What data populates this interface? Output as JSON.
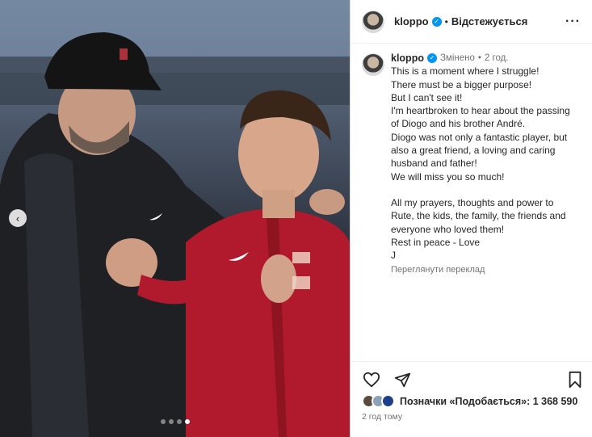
{
  "post": {
    "username": "kloppo",
    "dot": "•",
    "follow_label": "Відстежується",
    "more_label": "···",
    "carousel_prev_label": "‹",
    "caption": {
      "username": "kloppo",
      "edited_label": "Змінено",
      "dot": "•",
      "time": "2 год.",
      "lines": [
        "This is a moment where I struggle!",
        "There must be a bigger purpose!",
        "But I can't see it!",
        "I'm heartbroken to hear about the passing",
        "of Diogo and his brother André.",
        "Diogo was not only a fantastic player, but",
        "also a great friend, a loving and caring",
        "husband and father!",
        "We will miss you so much!",
        "",
        "All my prayers, thoughts and power to",
        "Rute, the kids, the family, the friends and",
        "everyone who loved them!",
        "Rest in peace - Love",
        "J"
      ],
      "translate_label": "Переглянути переклад"
    },
    "likes_text": "Позначки «Подобається»: 1 368 590",
    "posted_time": "2 год тому",
    "carousel": {
      "count": 4,
      "active_index": 3
    }
  },
  "icons": {
    "like": "heart-icon",
    "share": "paper-plane-icon",
    "save": "bookmark-icon",
    "more": "more-horizontal-icon",
    "verified": "verified-badge-icon",
    "prev": "chevron-left-icon"
  },
  "colors": {
    "verified_blue": "#0095f6",
    "secondary_text": "#737373",
    "jersey_red": "#b01a2c",
    "border": "#dbdbdb"
  }
}
